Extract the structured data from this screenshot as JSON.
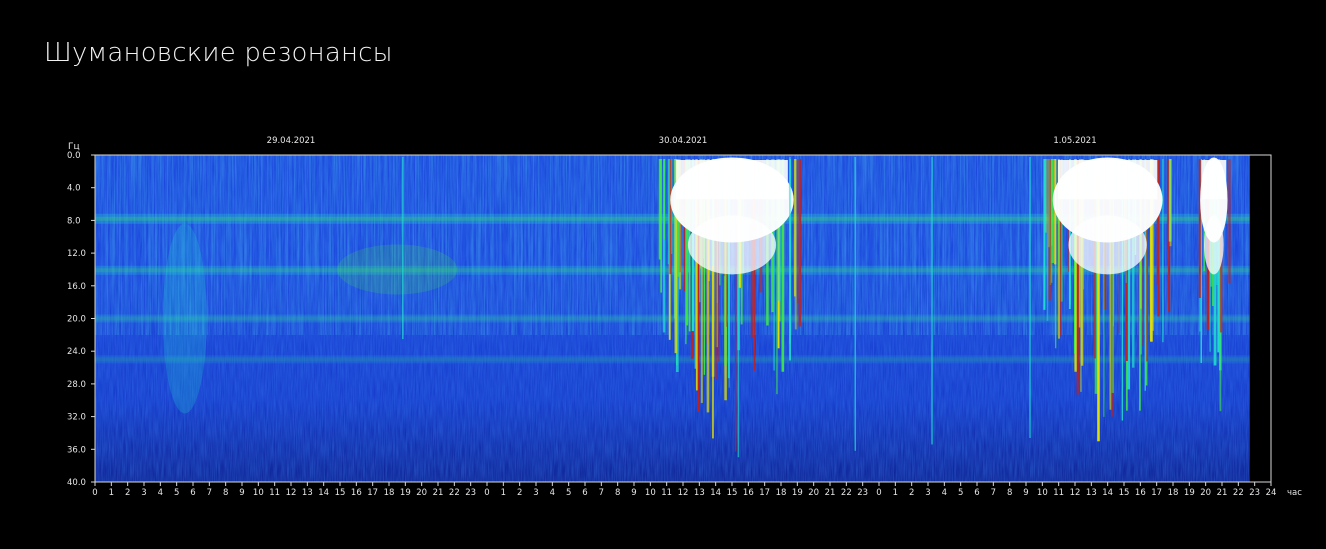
{
  "page": {
    "title": "Шумановские резонансы"
  },
  "chart_data": {
    "type": "heatmap",
    "title": "Шумановские резонансы",
    "ylabel": "Гц",
    "xlabel": "час",
    "ylim": [
      0,
      40
    ],
    "y_ticks": [
      "0.0",
      "4.0",
      "8.0",
      "12.0",
      "16.0",
      "20.0",
      "24.0",
      "28.0",
      "32.0",
      "36.0",
      "40.0"
    ],
    "x_ticks": [
      "0",
      "1",
      "2",
      "3",
      "4",
      "5",
      "6",
      "7",
      "8",
      "9",
      "10",
      "11",
      "12",
      "13",
      "14",
      "15",
      "16",
      "17",
      "18",
      "19",
      "20",
      "21",
      "22",
      "23",
      "0",
      "1",
      "2",
      "3",
      "4",
      "5",
      "6",
      "7",
      "8",
      "9",
      "10",
      "11",
      "12",
      "13",
      "14",
      "15",
      "16",
      "17",
      "18",
      "19",
      "20",
      "21",
      "22",
      "23",
      "0",
      "1",
      "2",
      "3",
      "4",
      "5",
      "6",
      "7",
      "8",
      "9",
      "10",
      "11",
      "12",
      "13",
      "14",
      "15",
      "16",
      "17",
      "18",
      "19",
      "20",
      "21",
      "22",
      "23",
      "24"
    ],
    "dates": [
      {
        "label": "29.04.2021",
        "hour": 12
      },
      {
        "label": "30.04.2021",
        "hour": 36
      },
      {
        "label": "1.05.2021",
        "hour": 60
      }
    ],
    "total_hours": 72,
    "data_end_hour": 70.7,
    "resonance_bands_hz": [
      7.8,
      14.1,
      20.0,
      25.0
    ],
    "colormap": [
      "#0a1a8a",
      "#1740d8",
      "#1e8cf0",
      "#20e0d0",
      "#40f040",
      "#e0e000",
      "#c02020",
      "#ffffff"
    ],
    "bursts": [
      {
        "start_hour": 34.5,
        "end_hour": 43.5,
        "level": "very high"
      },
      {
        "start_hour": 58.0,
        "end_hour": 66.0,
        "level": "very high"
      },
      {
        "start_hour": 67.5,
        "end_hour": 69.5,
        "level": "very high"
      }
    ]
  }
}
